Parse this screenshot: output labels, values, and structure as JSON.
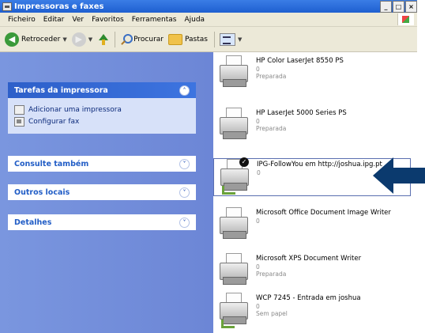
{
  "window": {
    "title": "Impressoras e faxes"
  },
  "menu": [
    "Ficheiro",
    "Editar",
    "Ver",
    "Favoritos",
    "Ferramentas",
    "Ajuda"
  ],
  "toolbar": {
    "back_label": "Retroceder",
    "search_label": "Procurar",
    "folders_label": "Pastas"
  },
  "sidebar": {
    "tasks_title": "Tarefas da impressora",
    "tasks": [
      "Adicionar uma impressora",
      "Configurar fax"
    ],
    "see_also_title": "Consulte também",
    "other_places_title": "Outros locais",
    "details_title": "Detalhes"
  },
  "printers": [
    {
      "name": "HP Color LaserJet 8550 PS",
      "count": "0",
      "status": "Preparada",
      "default": false,
      "network": false
    },
    {
      "name": "HP LaserJet 5000 Series PS",
      "count": "0",
      "status": "Preparada",
      "default": false,
      "network": false
    },
    {
      "name": "IPG-FollowYou em http://joshua.ipg.pt",
      "count": "0",
      "status": "",
      "default": true,
      "network": true,
      "selected": true
    },
    {
      "name": "Microsoft Office Document Image Writer",
      "count": "0",
      "status": "",
      "default": false,
      "network": false
    },
    {
      "name": "Microsoft XPS Document Writer",
      "count": "0",
      "status": "Preparada",
      "default": false,
      "network": false
    },
    {
      "name": "WCP 7245 - Entrada em joshua",
      "count": "0",
      "status": "Sem papel",
      "default": false,
      "network": true
    }
  ],
  "colors": {
    "accent_arrow": "#0b3a6e",
    "title_bar": "#1f5fd0",
    "sidebar": "#6c86d6"
  }
}
